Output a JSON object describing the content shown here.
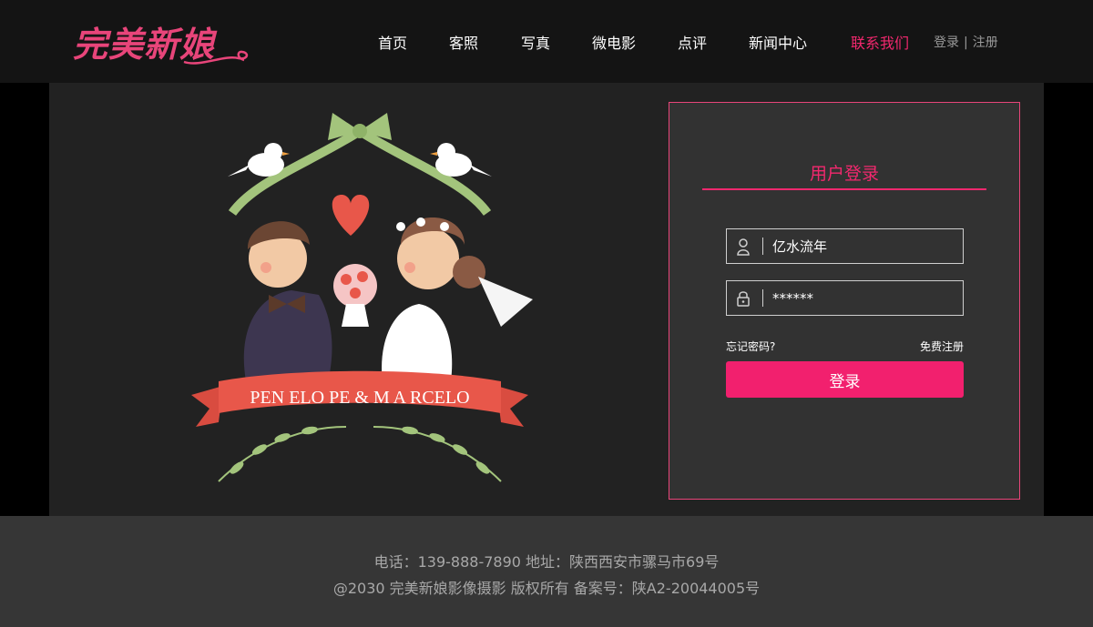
{
  "header": {
    "logo_text": "完美新娘",
    "nav": [
      "首页",
      "客照",
      "写真",
      "微电影",
      "点评",
      "新闻中心",
      "联系我们"
    ],
    "active_nav": "联系我们",
    "auth": {
      "login": "登录",
      "separator": "|",
      "register": "注册"
    }
  },
  "illustration": {
    "banner_text": "PEN ELO PE & M A RCELO"
  },
  "login_panel": {
    "title": "用户登录",
    "username": {
      "value": "亿水流年",
      "icon": "user-icon"
    },
    "password": {
      "value": "******",
      "icon": "lock-icon"
    },
    "forgot_label": "忘记密码?",
    "register_label": "免费注册",
    "submit_label": "登录"
  },
  "footer": {
    "line1": "电话：139-888-7890 地址：陕西西安市骡马市69号",
    "line2": "@2030 完美新娘影像摄影 版权所有 备案号：陕A2-20044005号"
  },
  "colors": {
    "accent": "#f2286e",
    "header_bg": "#141414",
    "main_bg": "#222222",
    "panel_bg": "#323232",
    "footer_bg": "#363636"
  }
}
